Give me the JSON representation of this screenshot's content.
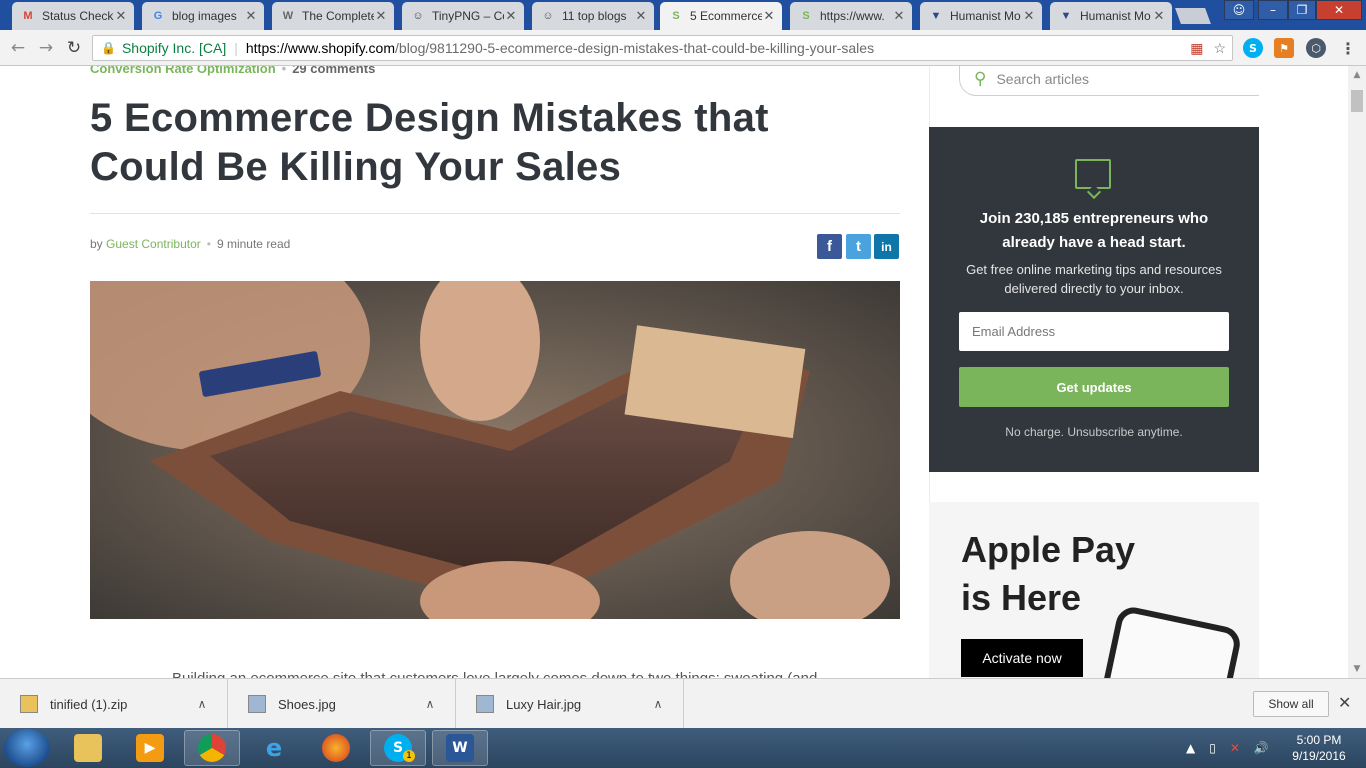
{
  "browser": {
    "tabs": [
      {
        "title": "Status Check",
        "favicon": "gmail-icon",
        "color": "#d44638",
        "glyph": "M"
      },
      {
        "title": "blog images",
        "favicon": "google-icon",
        "color": "#4285f4",
        "glyph": "G"
      },
      {
        "title": "The Complete",
        "favicon": "site-icon",
        "color": "#666666",
        "glyph": "W"
      },
      {
        "title": "TinyPNG – Co",
        "favicon": "panda-icon",
        "color": "#444444",
        "glyph": "☺"
      },
      {
        "title": "11 top blogs",
        "favicon": "face-icon",
        "color": "#555555",
        "glyph": "☺"
      },
      {
        "title": "5 Ecommerce",
        "favicon": "shopify-icon",
        "color": "#7ab55c",
        "glyph": "S",
        "active": true
      },
      {
        "title": "https://www.",
        "favicon": "shopify-icon",
        "color": "#7ab55c",
        "glyph": "S"
      },
      {
        "title": "Humanist Mo",
        "favicon": "bookmark-icon",
        "color": "#2b4a8b",
        "glyph": "▼"
      },
      {
        "title": "Humanist Mo",
        "favicon": "bookmark-icon",
        "color": "#2b4a8b",
        "glyph": "▼"
      }
    ],
    "address": {
      "org": "Shopify Inc. [CA]",
      "host": "https://www.shopify.com",
      "path": "/blog/9811290-5-ecommerce-design-mistakes-that-could-be-killing-your-sales"
    }
  },
  "article": {
    "category": "Conversion Rate Optimization",
    "comments": "29 comments",
    "title": "5 Ecommerce Design Mistakes that Could Be Killing Your Sales",
    "by": "by",
    "author": "Guest Contributor",
    "read_time": "9 minute read",
    "share": {
      "facebook": "f",
      "twitter": "t",
      "linkedin": "in"
    },
    "body_start": "Building an ecommerce site that customers love largely comes down to two things: sweating (and"
  },
  "sidebar": {
    "search_placeholder": "Search articles",
    "signup": {
      "heading": "Join 230,185 entrepreneurs who already have a head start.",
      "subtext": "Get free online marketing tips and resources delivered directly to your inbox.",
      "email_placeholder": "Email Address",
      "button": "Get updates",
      "note": "No charge. Unsubscribe anytime."
    },
    "promo": {
      "headline_1": "Apple Pay",
      "headline_2": "is Here",
      "button": "Activate now"
    }
  },
  "downloads": {
    "items": [
      {
        "name": "tinified (1).zip",
        "icon": "zip-file-icon"
      },
      {
        "name": "Shoes.jpg",
        "icon": "image-file-icon"
      },
      {
        "name": "Luxy Hair.jpg",
        "icon": "image-file-icon"
      }
    ],
    "show_all": "Show all"
  },
  "taskbar": {
    "time": "5:00 PM",
    "date": "9/19/2016",
    "skype_badge": "1"
  },
  "colors": {
    "accent": "#7ab55c",
    "dark": "#31373d",
    "chrome_frame": "#1f4f9e"
  }
}
